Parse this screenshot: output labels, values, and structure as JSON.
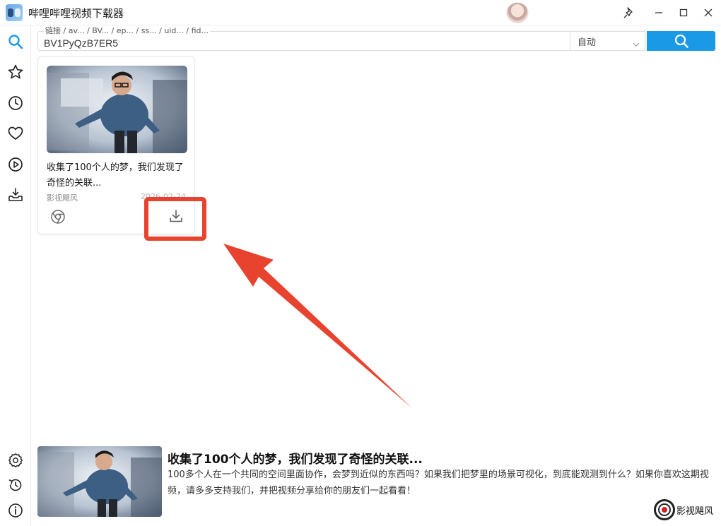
{
  "window": {
    "title": "哔哩哔哩视频下载器"
  },
  "search": {
    "hint": "链接 / av... / BV... / ep... / ss... / uid... / fid...",
    "value": "BV1PyQzB7ER5",
    "mode": "自动"
  },
  "sidebar": {
    "top_items": [
      "search-icon",
      "star-icon",
      "history-icon",
      "heart-icon",
      "play-icon",
      "download-tray-icon"
    ],
    "bottom_items": [
      "settings-icon",
      "refresh-history-icon",
      "info-icon"
    ]
  },
  "card": {
    "title": "收集了100个人的梦，我们发现了奇怪的关联...",
    "author": "影视飓风",
    "date": "2026-02-24"
  },
  "info": {
    "title": "收集了100个人的梦，我们发现了奇怪的关联...",
    "description": "100多个人在一个共同的空间里面协作，会梦到近似的东西吗？如果我们把梦里的场景可视化，到底能观测到什么？如果你喜欢这期视频，请多多支持我们，并把视频分享给你的朋友们一起看看！",
    "uploader": "影视飓风"
  },
  "colors": {
    "accent": "#1a9ae6",
    "annotation": "#e8432e"
  }
}
